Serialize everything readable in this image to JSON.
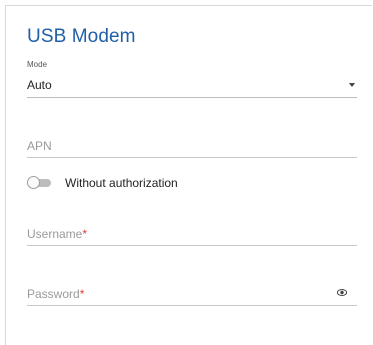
{
  "header": {
    "title": "USB Modem"
  },
  "mode": {
    "label": "Mode",
    "value": "Auto"
  },
  "apn": {
    "placeholder": "APN",
    "value": ""
  },
  "auth_toggle": {
    "label": "Without authorization",
    "enabled": false
  },
  "username": {
    "label": "Username",
    "required_mark": "*",
    "value": ""
  },
  "password": {
    "label": "Password",
    "required_mark": "*",
    "value": ""
  },
  "colors": {
    "accent": "#1f5fa8",
    "required": "#e53935"
  },
  "icons": {
    "dropdown": "chevron-down-icon",
    "visibility": "eye-icon"
  }
}
